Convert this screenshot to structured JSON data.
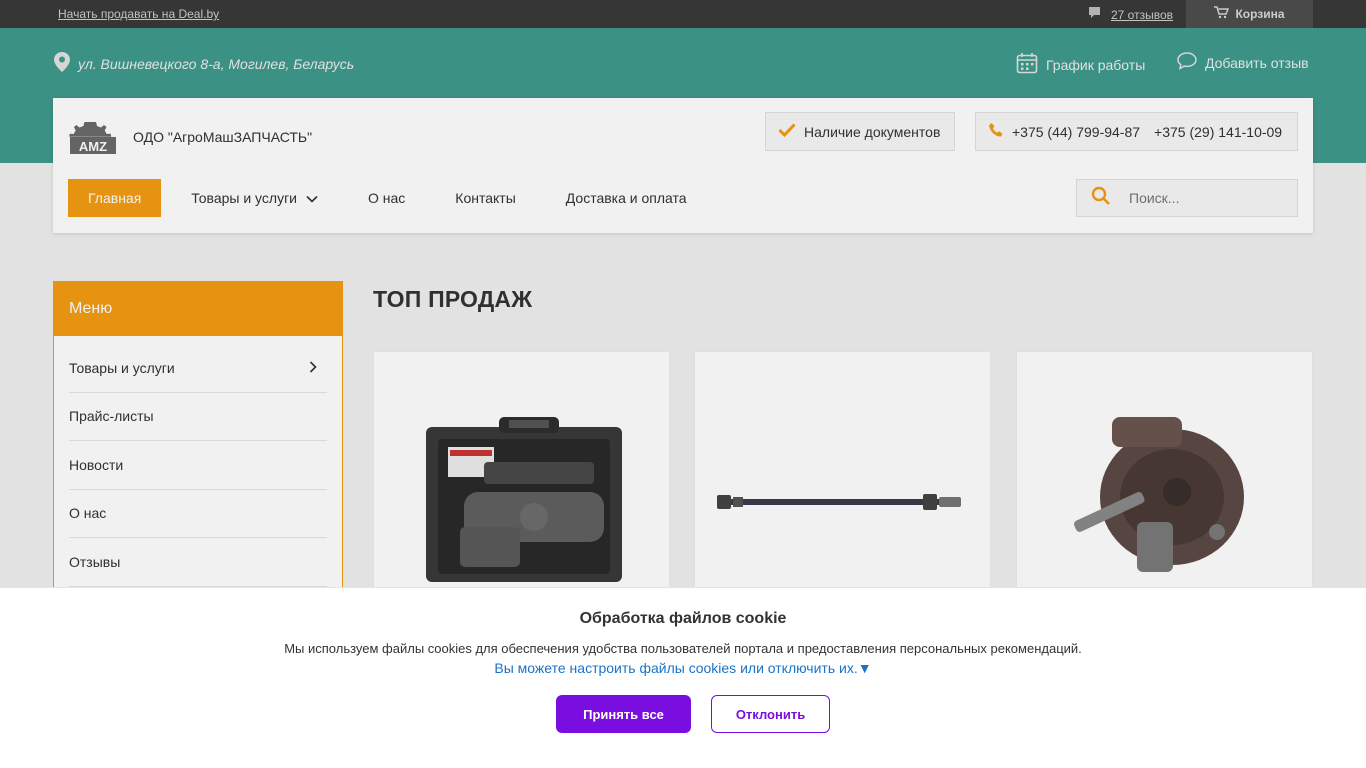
{
  "topbar": {
    "sell_link": "Начать продавать на Deal.by",
    "reviews": "27 отзывов",
    "cart": "Корзина"
  },
  "header": {
    "address": "ул. Вишневецкого 8-а, Могилев, Беларусь",
    "schedule": "График работы",
    "add_review": "Добавить отзыв",
    "company": "ОДО \"АгроМашЗАПЧАСТЬ\"",
    "docs": "Наличие документов",
    "phone1": "+375 (44) 799-94-87",
    "phone2": "+375 (29) 141-10-09",
    "logo_text": "AMZ"
  },
  "nav": {
    "items": [
      {
        "label": "Главная"
      },
      {
        "label": "Товары и услуги"
      },
      {
        "label": "О нас"
      },
      {
        "label": "Контакты"
      },
      {
        "label": "Доставка и оплата"
      }
    ]
  },
  "search": {
    "placeholder": "Поиск..."
  },
  "sidebar": {
    "title": "Меню",
    "items": [
      {
        "label": "Товары и услуги"
      },
      {
        "label": "Прайс-листы"
      },
      {
        "label": "Новости"
      },
      {
        "label": "О нас"
      },
      {
        "label": "Отзывы"
      }
    ]
  },
  "main": {
    "title": "ТОП ПРОДАЖ"
  },
  "cookie": {
    "title": "Обработка файлов cookie",
    "text": "Мы используем файлы cookies для обеспечения удобства пользователей портала и предоставления персональных рекомендаций.",
    "link": "Вы можете настроить файлы cookies или отключить их.▼",
    "accept": "Принять все",
    "decline": "Отклонить"
  },
  "colors": {
    "accent": "#f39c12",
    "teal": "#3f9a8b",
    "cookie_button": "#7a0ee0",
    "link": "#1a73c8"
  }
}
